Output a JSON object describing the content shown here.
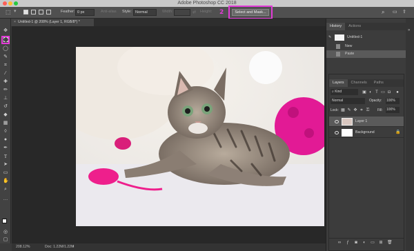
{
  "window": {
    "title": "Adobe Photoshop CC 2018"
  },
  "options_bar": {
    "feather_label": "Feather:",
    "feather_value": "0 px",
    "anti_alias_label": "Anti-alias",
    "style_label": "Style:",
    "style_value": "Normal",
    "width_label": "Width:",
    "height_label": "Height:",
    "select_mask_button": "Select and Mask..."
  },
  "document": {
    "tab_label": "Untitled-1 @ 208% (Layer 1, RGB/8*) *"
  },
  "status_bar": {
    "zoom": "208.12%",
    "doc_info": "Doc: 1.22M/1.22M"
  },
  "annotations": {
    "step1": "1",
    "step2": "2"
  },
  "history_panel": {
    "tabs": [
      "History",
      "Actions"
    ],
    "snapshot": "Untitled-1",
    "items": [
      "New",
      "Paste"
    ]
  },
  "layers_panel": {
    "tabs": [
      "Layers",
      "Channels",
      "Paths"
    ],
    "kind_filter": "Kind",
    "blend_mode": "Normal",
    "opacity_label": "Opacity:",
    "opacity_value": "100%",
    "lock_label": "Lock:",
    "fill_label": "Fill:",
    "fill_value": "100%",
    "layers": [
      {
        "name": "Layer 1",
        "selected": true
      },
      {
        "name": "Background",
        "selected": false
      }
    ]
  },
  "colors": {
    "annotation": "#e33bd8",
    "selected_row": "#5a5a5a"
  }
}
